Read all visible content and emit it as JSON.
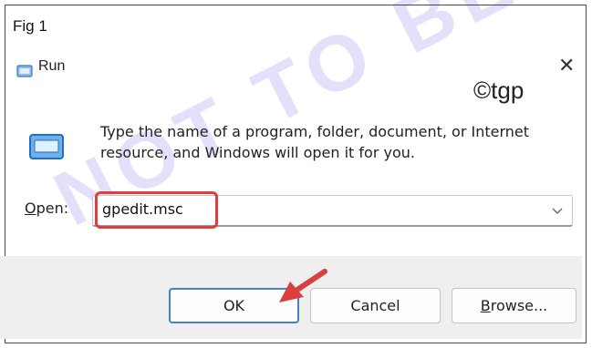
{
  "figure_label": "Fig 1",
  "watermark_text": "NOT TO BE",
  "copyright": "©tgp",
  "dialog": {
    "title": "Run",
    "close_glyph": "✕",
    "description": "Type the name of a program, folder, document, or Internet resource, and Windows will open it for you.",
    "open_label_underlined": "O",
    "open_label_rest": "pen:",
    "open_value": "gpedit.msc",
    "buttons": {
      "ok": "OK",
      "cancel": "Cancel",
      "browse_underlined": "B",
      "browse_rest": "rowse..."
    }
  },
  "colors": {
    "accent_blue": "#4a7ec8",
    "highlight_red": "#d9403f",
    "watermark_blue": "#2c24d6"
  }
}
